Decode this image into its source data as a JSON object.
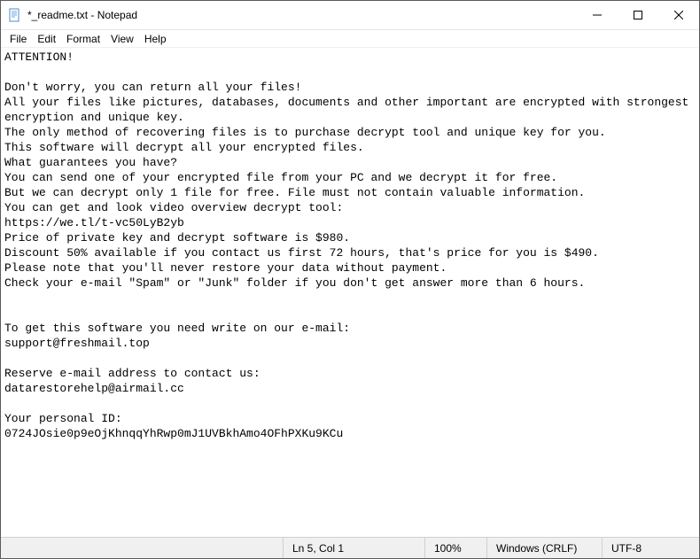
{
  "titlebar": {
    "title": "*_readme.txt - Notepad"
  },
  "menu": {
    "file": "File",
    "edit": "Edit",
    "format": "Format",
    "view": "View",
    "help": "Help"
  },
  "content": {
    "text": "ATTENTION!\n\nDon't worry, you can return all your files!\nAll your files like pictures, databases, documents and other important are encrypted with strongest encryption and unique key.\nThe only method of recovering files is to purchase decrypt tool and unique key for you.\nThis software will decrypt all your encrypted files.\nWhat guarantees you have?\nYou can send one of your encrypted file from your PC and we decrypt it for free.\nBut we can decrypt only 1 file for free. File must not contain valuable information.\nYou can get and look video overview decrypt tool:\nhttps://we.tl/t-vc50LyB2yb\nPrice of private key and decrypt software is $980.\nDiscount 50% available if you contact us first 72 hours, that's price for you is $490.\nPlease note that you'll never restore your data without payment.\nCheck your e-mail \"Spam\" or \"Junk\" folder if you don't get answer more than 6 hours.\n\n\nTo get this software you need write on our e-mail:\nsupport@freshmail.top\n\nReserve e-mail address to contact us:\ndatarestorehelp@airmail.cc\n\nYour personal ID:\n0724JOsie0p9eOjKhnqqYhRwp0mJ1UVBkhAmo4OFhPXKu9KCu"
  },
  "statusbar": {
    "position": "Ln 5, Col 1",
    "zoom": "100%",
    "eol": "Windows (CRLF)",
    "encoding": "UTF-8"
  }
}
